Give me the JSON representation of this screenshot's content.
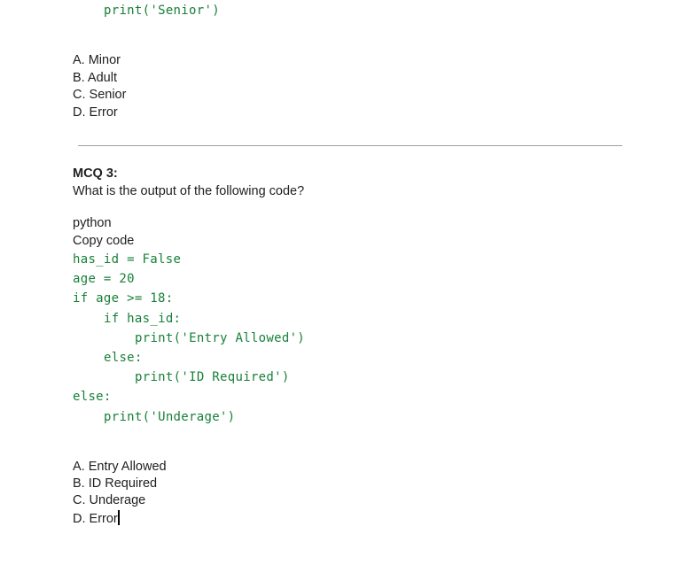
{
  "prev_question": {
    "code_tail": "print('Senior')",
    "options": [
      "A. Minor",
      "B. Adult",
      "C. Senior",
      "D. Error"
    ]
  },
  "mcq3": {
    "title": "MCQ 3:",
    "question": "What is the output of the following code?",
    "lang_label": "python",
    "copy_label": "Copy code",
    "code_lines": [
      {
        "indent": 0,
        "text": "has_id = False"
      },
      {
        "indent": 0,
        "text": "age = 20"
      },
      {
        "indent": 0,
        "text": "if age >= 18:"
      },
      {
        "indent": 1,
        "text": "if has_id:"
      },
      {
        "indent": 2,
        "text": "print('Entry Allowed')"
      },
      {
        "indent": 1,
        "text": "else:"
      },
      {
        "indent": 2,
        "text": "print('ID Required')"
      },
      {
        "indent": 0,
        "text": "else:"
      },
      {
        "indent": 1,
        "text": "print('Underage')"
      }
    ],
    "options": [
      "A. Entry Allowed",
      "B. ID Required",
      "C. Underage",
      "D. Error"
    ]
  },
  "colors": {
    "code": "#188038",
    "text": "#1f1f1f",
    "divider": "#a0a0a0"
  }
}
